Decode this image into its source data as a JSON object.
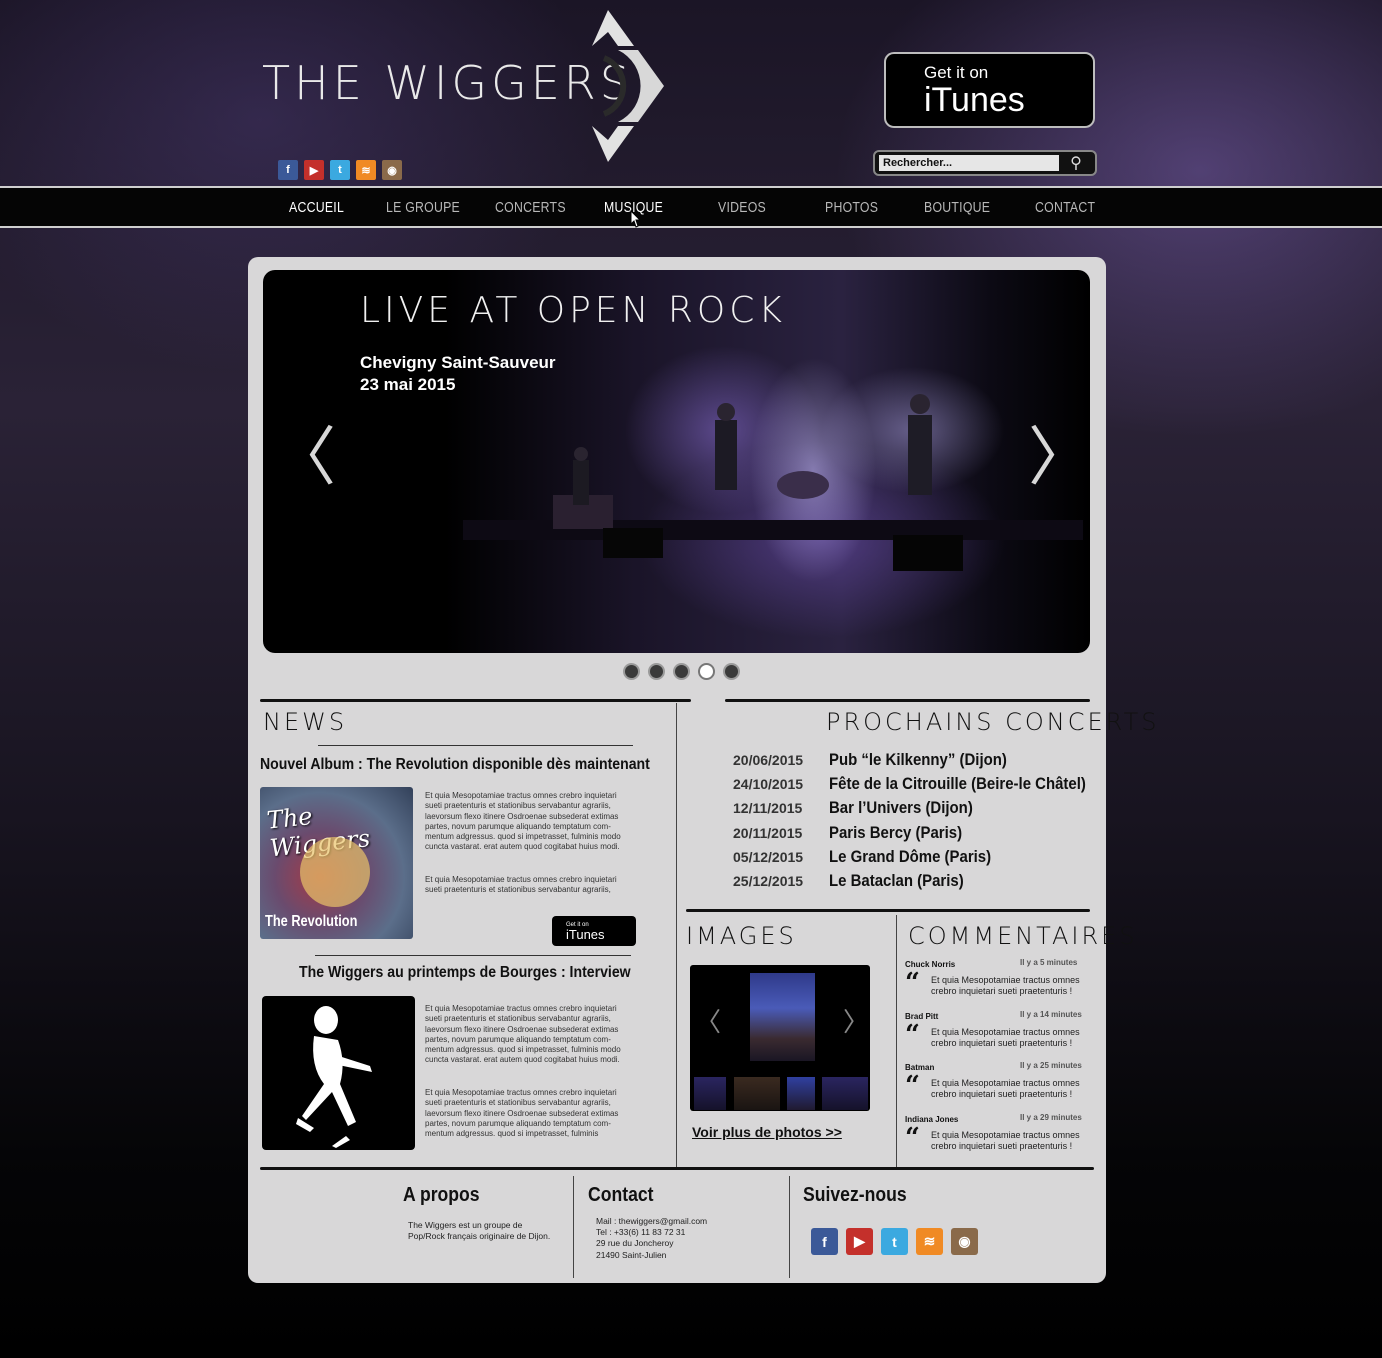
{
  "header": {
    "logo_text": "THE WIGGERS",
    "itunes_top": "Get it on",
    "itunes_bottom": "iTunes",
    "search_placeholder": "Rechercher...",
    "social_top": [
      {
        "icon": "facebook-icon",
        "glyph": "f",
        "color": "#3b5998"
      },
      {
        "icon": "youtube-icon",
        "glyph": "You Tube",
        "color": "#c4302b"
      },
      {
        "icon": "twitter-icon",
        "glyph": "t",
        "color": "#3ba9e0"
      },
      {
        "icon": "rss-icon",
        "glyph": "≋",
        "color": "#f08a24"
      },
      {
        "icon": "instagram-icon",
        "glyph": "◉",
        "color": "#8a6a4a"
      }
    ]
  },
  "nav": {
    "items": [
      "ACCUEIL",
      "LE GROUPE",
      "CONCERTS",
      "MUSIQUE",
      "VIDEOS",
      "PHOTOS",
      "BOUTIQUE",
      "CONTACT"
    ],
    "active": "ACCUEIL"
  },
  "slider": {
    "title": "LIVE AT OPEN ROCK",
    "subtitle_line1": "Chevigny Saint-Sauveur",
    "subtitle_line2": "23 mai 2015",
    "prev_glyph": "〈",
    "next_glyph": "〉",
    "dot_count": 5,
    "active_dot": 4
  },
  "news": {
    "title": "NEWS",
    "item1": {
      "headline": "Nouvel Album : The Revolution disponible dès maintenant",
      "cover_script": "The Wiggers",
      "cover_caption": "The Revolution",
      "para1": "Et quia Mesopotamiae tractus omnes crebro inquietari sueti praetenturis et stationibus servabantur agrariis, laevorsum flexo itinere Osdroenae subsederat extimas partes, novum parumque aliquando temptatum com-mentum adgressus. quod si impetrasset, fulminis modo cuncta vastarat. erat autem quod cogitabat huius modi.",
      "para2": "Et quia Mesopotamiae tractus omnes crebro inquietari sueti praetenturis et stationibus servabantur agrariis,",
      "itunes_top": "Get it on",
      "itunes_bottom": "iTunes"
    },
    "item2": {
      "headline": "The Wiggers au printemps de Bourges : Interview",
      "para1": "Et quia Mesopotamiae tractus omnes crebro inquietari sueti praetenturis et stationibus servabantur agrariis, laevorsum flexo itinere Osdroenae subsederat extimas partes, novum parumque aliquando temptatum com-mentum adgressus. quod si impetrasset, fulminis modo cuncta vastarat. erat autem quod cogitabat huius modi.",
      "para2": "Et quia Mesopotamiae tractus omnes crebro inquietari sueti praetenturis et stationibus servabantur agrariis, laevorsum flexo itinere Osdroenae subsederat extimas partes, novum parumque aliquando temptatum com-mentum adgressus. quod si impetrasset, fulminis"
    }
  },
  "concerts": {
    "title": "PROCHAINS CONCERTS",
    "rows": [
      {
        "date": "20/06/2015",
        "place": "Pub “le Kilkenny” (Dijon)"
      },
      {
        "date": "24/10/2015",
        "place": "Fête de la Citrouille (Beire-le Châtel)"
      },
      {
        "date": "12/11/2015",
        "place": "Bar l’Univers (Dijon)"
      },
      {
        "date": "20/11/2015",
        "place": "Paris Bercy (Paris)"
      },
      {
        "date": "05/12/2015",
        "place": "Le Grand Dôme (Paris)"
      },
      {
        "date": "25/12/2015",
        "place": "Le Bataclan (Paris)"
      }
    ]
  },
  "images": {
    "title": "IMAGES",
    "more_link": "Voir plus de photos >>",
    "prev_glyph": "〈",
    "next_glyph": "〉"
  },
  "comments": {
    "title": "COMMENTAIRES",
    "items": [
      {
        "author": "Chuck Norris",
        "time": "Il y a 5 minutes",
        "text": "Et quia Mesopotamiae tractus omnes crebro inquietari sueti praetenturis !"
      },
      {
        "author": "Brad Pitt",
        "time": "Il y a 14 minutes",
        "text": "Et quia Mesopotamiae tractus omnes crebro inquietari sueti praetenturis !"
      },
      {
        "author": "Batman",
        "time": "Il y a 25 minutes",
        "text": "Et quia Mesopotamiae tractus omnes crebro inquietari sueti praetenturis !"
      },
      {
        "author": "Indiana Jones",
        "time": "Il y a 29 minutes",
        "text": "Et quia Mesopotamiae tractus omnes crebro inquietari sueti praetenturis !"
      }
    ]
  },
  "footer": {
    "about_title": "A propos",
    "about_text": "The Wiggers est un groupe de\nPop/Rock français originaire de Dijon.",
    "contact_title": "Contact",
    "contact_text": "Mail : thewiggers@gmail.com\nTel : +33(6) 11 83 72 31\n29 rue du Joncheroy\n21490 Saint-Julien",
    "follow_title": "Suivez-nous",
    "social": [
      {
        "icon": "facebook-icon",
        "glyph": "f",
        "color": "#3b5998"
      },
      {
        "icon": "youtube-icon",
        "glyph": "You Tube",
        "color": "#c4302b"
      },
      {
        "icon": "twitter-icon",
        "glyph": "t",
        "color": "#3ba9e0"
      },
      {
        "icon": "rss-icon",
        "glyph": "≋",
        "color": "#f08a24"
      },
      {
        "icon": "instagram-icon",
        "glyph": "◉",
        "color": "#8a6a4a"
      }
    ]
  }
}
